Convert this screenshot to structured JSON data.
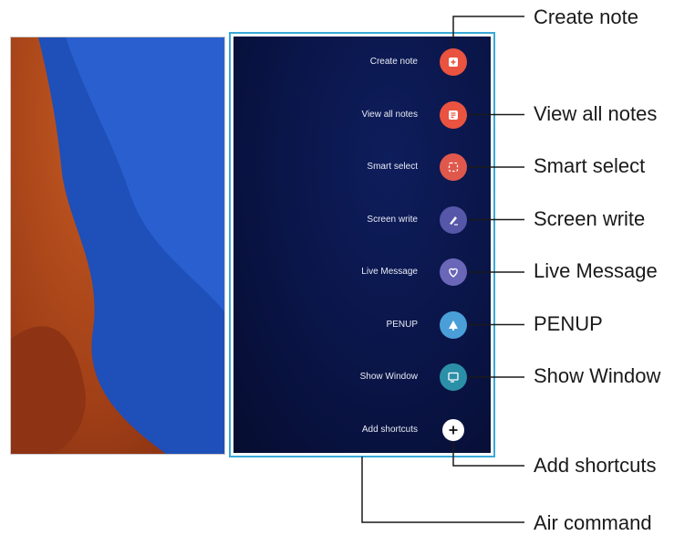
{
  "commands": [
    {
      "label": "Create note",
      "callout": "Create note",
      "color": "#e9533f",
      "icon": "create-note-icon"
    },
    {
      "label": "View all notes",
      "callout": "View all notes",
      "color": "#e9533f",
      "icon": "view-all-notes-icon"
    },
    {
      "label": "Smart select",
      "callout": "Smart select",
      "color": "#e0584c",
      "icon": "smart-select-icon"
    },
    {
      "label": "Screen write",
      "callout": "Screen write",
      "color": "#5657a8",
      "icon": "screen-write-icon"
    },
    {
      "label": "Live Message",
      "callout": "Live Message",
      "color": "#6a66b8",
      "icon": "live-message-icon"
    },
    {
      "label": "PENUP",
      "callout": "PENUP",
      "color": "#4a9fd8",
      "icon": "penup-icon"
    },
    {
      "label": "Show Window",
      "callout": "Show Window",
      "color": "#2c8fa8",
      "icon": "show-window-icon"
    },
    {
      "label": "Add shortcuts",
      "callout": "Add shortcuts",
      "color": "#ffffff",
      "icon": "plus-icon"
    }
  ],
  "panel_callout": "Air command",
  "colors": {
    "accent_line": "#3aa9d8",
    "panel_bg": "#0a1548"
  }
}
